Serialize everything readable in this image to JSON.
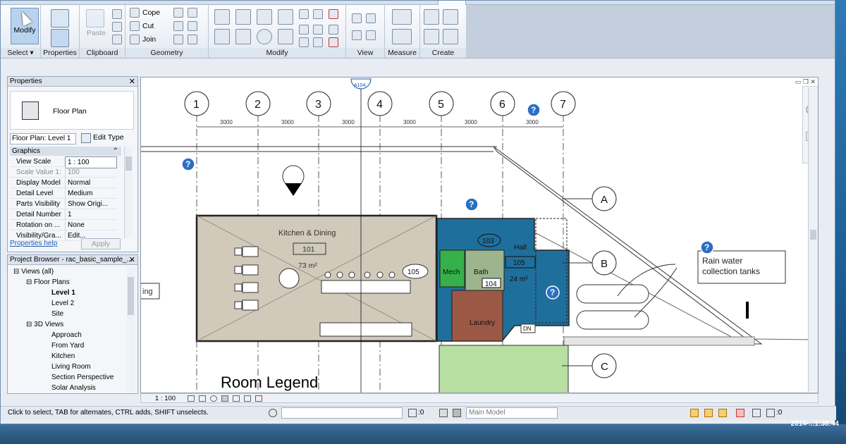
{
  "ribbon": {
    "select": {
      "modify_label": "Modify",
      "group_label": "Select ▾"
    },
    "properties": {
      "group_label": "Properties"
    },
    "clipboard": {
      "paste_label": "Paste",
      "group_label": "Clipboard"
    },
    "geometry": {
      "cope_label": "Cope",
      "cut_label": "Cut",
      "join_label": "Join",
      "group_label": "Geometry"
    },
    "modify": {
      "group_label": "Modify"
    },
    "view": {
      "group_label": "View"
    },
    "measure": {
      "group_label": "Measure"
    },
    "create": {
      "group_label": "Create"
    }
  },
  "properties_panel": {
    "title": "Properties",
    "type_name": "Floor Plan",
    "selector": "Floor Plan: Level 1",
    "edit_type": "Edit Type",
    "section": "Graphics",
    "rows": [
      {
        "k": "View Scale",
        "v": "1 : 100"
      },
      {
        "k": "Scale Value    1:",
        "v": "100"
      },
      {
        "k": "Display Model",
        "v": "Normal"
      },
      {
        "k": "Detail Level",
        "v": "Medium"
      },
      {
        "k": "Parts Visibility",
        "v": "Show Origi..."
      },
      {
        "k": "Detail Number",
        "v": "1"
      },
      {
        "k": "Rotation on ...",
        "v": "None"
      },
      {
        "k": "Visibility/Gra...",
        "v": "Edit..."
      }
    ],
    "help_link": "Properties help",
    "apply": "Apply"
  },
  "project_browser": {
    "title": "Project Browser - rac_basic_sample_...",
    "items": [
      {
        "label": "Views (all)",
        "bold": false
      },
      {
        "label": "Floor Plans",
        "bold": false
      },
      {
        "label": "Level 1",
        "bold": true
      },
      {
        "label": "Level 2",
        "bold": false
      },
      {
        "label": "Site",
        "bold": false
      },
      {
        "label": "3D Views",
        "bold": false
      },
      {
        "label": "Approach",
        "bold": false
      },
      {
        "label": "From Yard",
        "bold": false
      },
      {
        "label": "Kitchen",
        "bold": false
      },
      {
        "label": "Living Room",
        "bold": false
      },
      {
        "label": "Section Perspective",
        "bold": false
      },
      {
        "label": "Solar Analysis",
        "bold": false
      }
    ]
  },
  "drawing": {
    "grid_labels": [
      "1",
      "2",
      "3",
      "4",
      "5",
      "6",
      "7"
    ],
    "dimension": "3000",
    "row_labels": [
      "A",
      "B",
      "C"
    ],
    "section_tag": "A104",
    "rooms": {
      "kitchen_name": "Kitchen & Dining",
      "kitchen_number": "101",
      "kitchen_area": "73 m²",
      "hall_name": "Hall",
      "hall_number": "105",
      "hall_area": "24 m²",
      "mech": "Mech",
      "bath": "Bath",
      "laundry": "Laundry",
      "tag_103": "103",
      "tag_104": "104",
      "tag_105": "105",
      "dn": "DN",
      "left_fragment": "ing"
    },
    "callout_line1": "Rain water",
    "callout_line2": "collection tanks",
    "legend_title": "Room Legend",
    "help_badge": "?",
    "view_scale": "1 : 100"
  },
  "status": {
    "hint": "Click to select, TAB for alternates, CTRL adds, SHIFT unselects.",
    "count1": ":0",
    "model": "Main Model",
    "count2": ":0"
  },
  "taskbar": {
    "clock": "2014-...1:38:44"
  },
  "colors": {
    "kitchen": "#d1cabb",
    "hall": "#1f6f9c",
    "mech": "#35b04a",
    "bath": "#9db58e",
    "laundry": "#9a5845",
    "lawn": "#b7dfa2",
    "help": "#2b6fc4"
  }
}
